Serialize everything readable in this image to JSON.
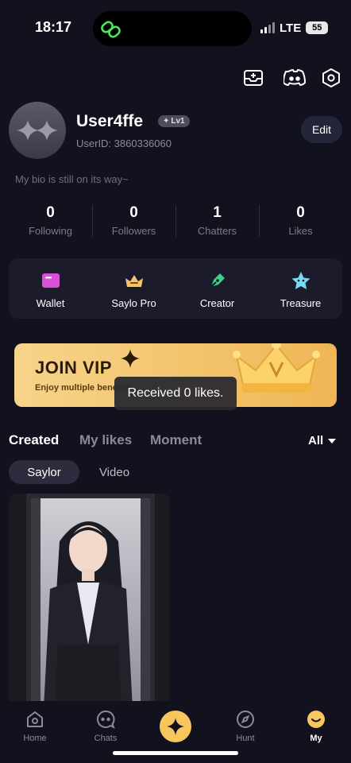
{
  "status_bar": {
    "time": "18:17",
    "network": "LTE",
    "battery": "55"
  },
  "header": {
    "icons": [
      "inbox-icon",
      "discord-icon",
      "settings-hex-icon"
    ]
  },
  "profile": {
    "username": "User4ffe",
    "level": "Lv1",
    "user_id": "UserID: 3860336060",
    "edit_label": "Edit",
    "bio": "My bio is still on its way~"
  },
  "stats": [
    {
      "value": "0",
      "label": "Following"
    },
    {
      "value": "0",
      "label": "Followers"
    },
    {
      "value": "1",
      "label": "Chatters"
    },
    {
      "value": "0",
      "label": "Likes"
    }
  ],
  "actions": [
    {
      "label": "Wallet",
      "icon": "wallet-icon",
      "color": "#d94fd6"
    },
    {
      "label": "Saylo Pro",
      "icon": "crown-icon",
      "color": "#f3c46d"
    },
    {
      "label": "Creator",
      "icon": "pen-icon",
      "color": "#3ecf8e"
    },
    {
      "label": "Treasure",
      "icon": "treasure-star-icon",
      "color": "#7ad8f0"
    }
  ],
  "vip_banner": {
    "title": "JOIN VIP",
    "subtitle": "Enjoy multiple benefits"
  },
  "toast": "Received 0 likes.",
  "content_tabs": [
    {
      "label": "Created",
      "active": true
    },
    {
      "label": "My likes",
      "active": false
    },
    {
      "label": "Moment",
      "active": false
    }
  ],
  "filter": {
    "label": "All"
  },
  "chips": [
    {
      "label": "Saylor",
      "active": true
    },
    {
      "label": "Video",
      "active": false
    }
  ],
  "bottom_nav": [
    {
      "label": "Home",
      "icon": "home-icon"
    },
    {
      "label": "Chats",
      "icon": "chat-icon"
    },
    {
      "label": "",
      "icon": "sparkle-icon"
    },
    {
      "label": "Hunt",
      "icon": "compass-icon"
    },
    {
      "label": "My",
      "icon": "smile-icon",
      "active": true
    }
  ],
  "colors": {
    "background": "#12121f",
    "accent": "#f8c55e",
    "surface": "#1b1b2c"
  }
}
